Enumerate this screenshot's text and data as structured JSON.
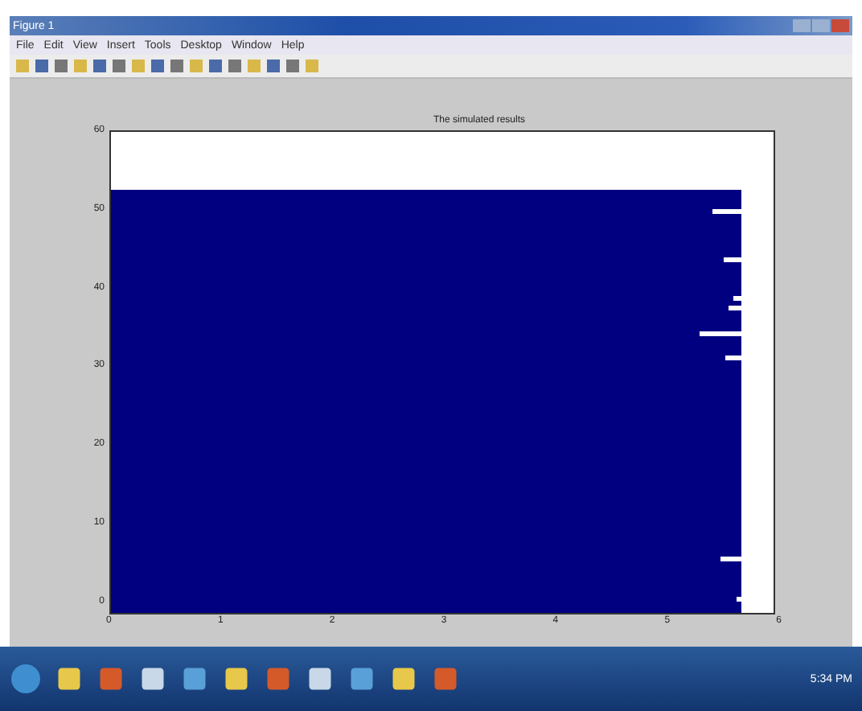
{
  "window": {
    "title": "Figure 1"
  },
  "menu": [
    "File",
    "Edit",
    "View",
    "Insert",
    "Tools",
    "Desktop",
    "Window",
    "Help"
  ],
  "axes": {
    "title": "The simulated results",
    "yticks": [
      "60",
      "50",
      "40",
      "30",
      "20",
      "10",
      "0"
    ],
    "xticks": [
      "0",
      "1",
      "2",
      "3",
      "4",
      "5",
      "6"
    ]
  },
  "taskbar": {
    "clock": "5:34 PM"
  }
}
